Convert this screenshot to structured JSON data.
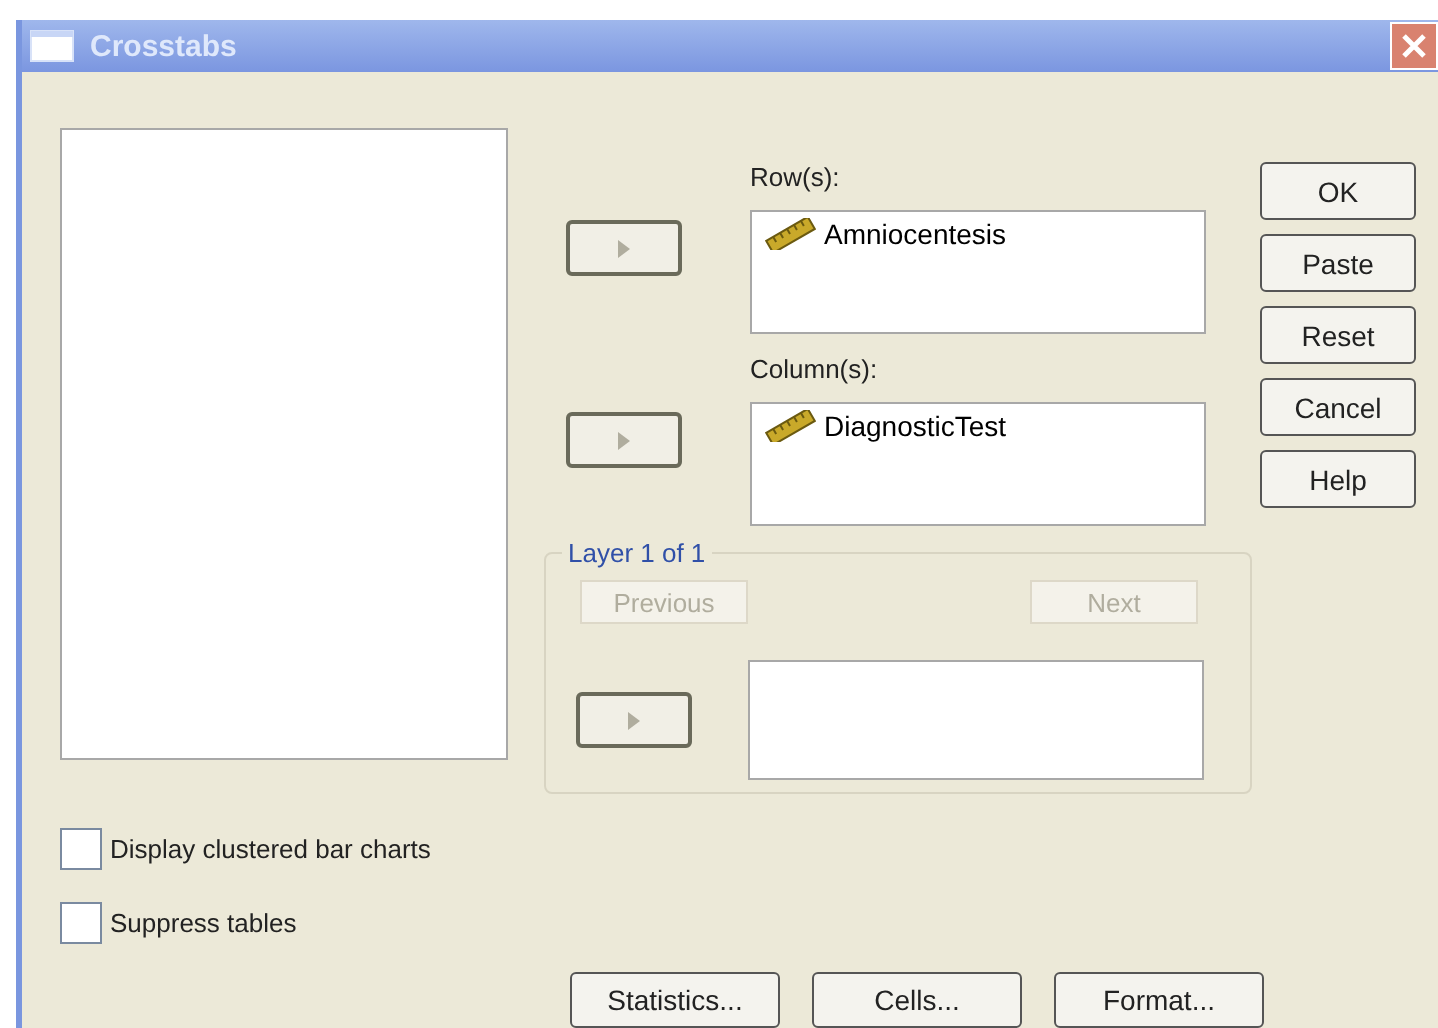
{
  "window": {
    "title": "Crosstabs"
  },
  "rows": {
    "label": "Row(s):",
    "items": [
      "Amniocentesis"
    ]
  },
  "columns": {
    "label": "Column(s):",
    "items": [
      "DiagnosticTest"
    ]
  },
  "layer": {
    "label": "Layer 1 of 1",
    "previous": {
      "label": "Previous",
      "disabled": true
    },
    "next": {
      "label": "Next",
      "disabled": true
    }
  },
  "side_buttons": [
    "OK",
    "Paste",
    "Reset",
    "Cancel",
    "Help"
  ],
  "options": [
    {
      "label": "Display clustered bar charts",
      "checked": false
    },
    {
      "label": "Suppress tables",
      "checked": false
    }
  ],
  "bottom_buttons": [
    "Statistics...",
    "Cells...",
    "Format..."
  ]
}
